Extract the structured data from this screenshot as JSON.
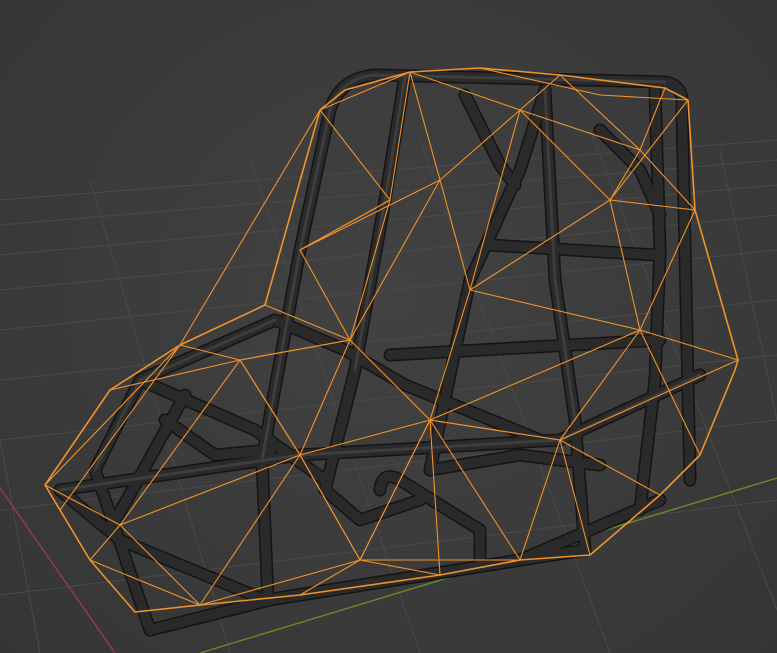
{
  "viewport": {
    "mode": "3d-viewport",
    "background": "#3a3a3a",
    "grid_color": "#4a4a4a",
    "axis_x_color": "#9a3a4a",
    "axis_y_color": "#6a8a2a",
    "object": {
      "name": "",
      "selected": true,
      "selection_color": "#f0922a",
      "tube_color": "#2a2a2a",
      "display": "solid-with-wireframe-overlay"
    }
  }
}
